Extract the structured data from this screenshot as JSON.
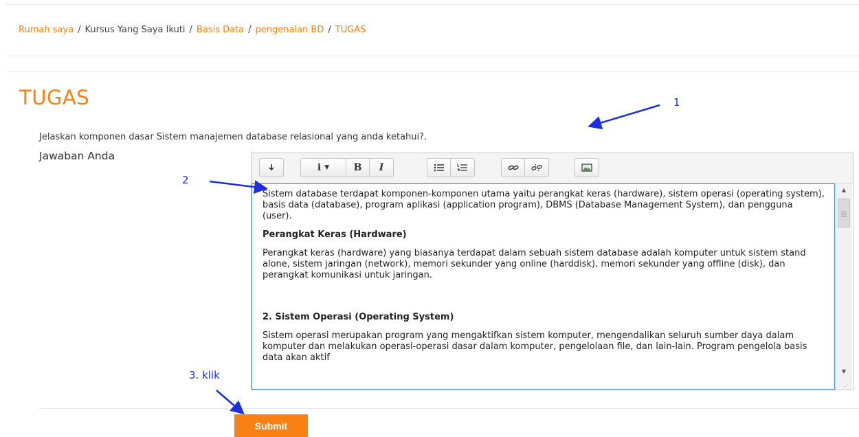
{
  "breadcrumb": {
    "items": [
      {
        "label": "Rumah saya",
        "link": true
      },
      {
        "label": "Kursus Yang Saya Ikuti",
        "link": false
      },
      {
        "label": "Basis Data",
        "link": true
      },
      {
        "label": "pengenalan BD",
        "link": true
      },
      {
        "label": "TUGAS",
        "link": true
      }
    ],
    "separator": "/"
  },
  "page": {
    "title": "TUGAS",
    "question": "Jelaskan komponen dasar Sistem manajemen database relasional yang anda ketahui?.",
    "answer_label": "Jawaban Anda"
  },
  "toolbar": {
    "icons": [
      "collapse-icon",
      "paragraph-style-icon",
      "bold-icon",
      "italic-icon",
      "unordered-list-icon",
      "ordered-list-icon",
      "link-icon",
      "unlink-icon",
      "image-icon"
    ]
  },
  "editor": {
    "p1": "Sistem database terdapat komponen-komponen utama yaitu perangkat keras (hardware), sistem operasi (operating system), basis data (database), program aplikasi (application program), DBMS (Database Management System), dan pengguna (user).",
    "h1": "Perangkat Keras (Hardware)",
    "p2": "Perangkat keras (hardware) yang biasanya terdapat dalam sebuah sistem database adalah komputer untuk sistem stand alone, sistem jaringan (network), memori sekunder yang online (harddisk), memori sekunder yang offline (disk), dan perangkat komunikasi untuk jaringan.",
    "h2": "2. Sistem Operasi (Operating System)",
    "p3": "Sistem operasi merupakan program yang mengaktifkan sistem komputer, mengendalikan seluruh sumber daya dalam komputer dan melakukan operasi-operasi dasar dalam komputer, pengelolaan file, dan lain-lain. Program pengelola basis data akan aktif"
  },
  "actions": {
    "submit_label": "Submit"
  },
  "annotations": {
    "a1": "1",
    "a2": "2",
    "a3": "3. klik"
  },
  "colors": {
    "accent": "#f98012",
    "annotation": "#1b2ee0"
  }
}
